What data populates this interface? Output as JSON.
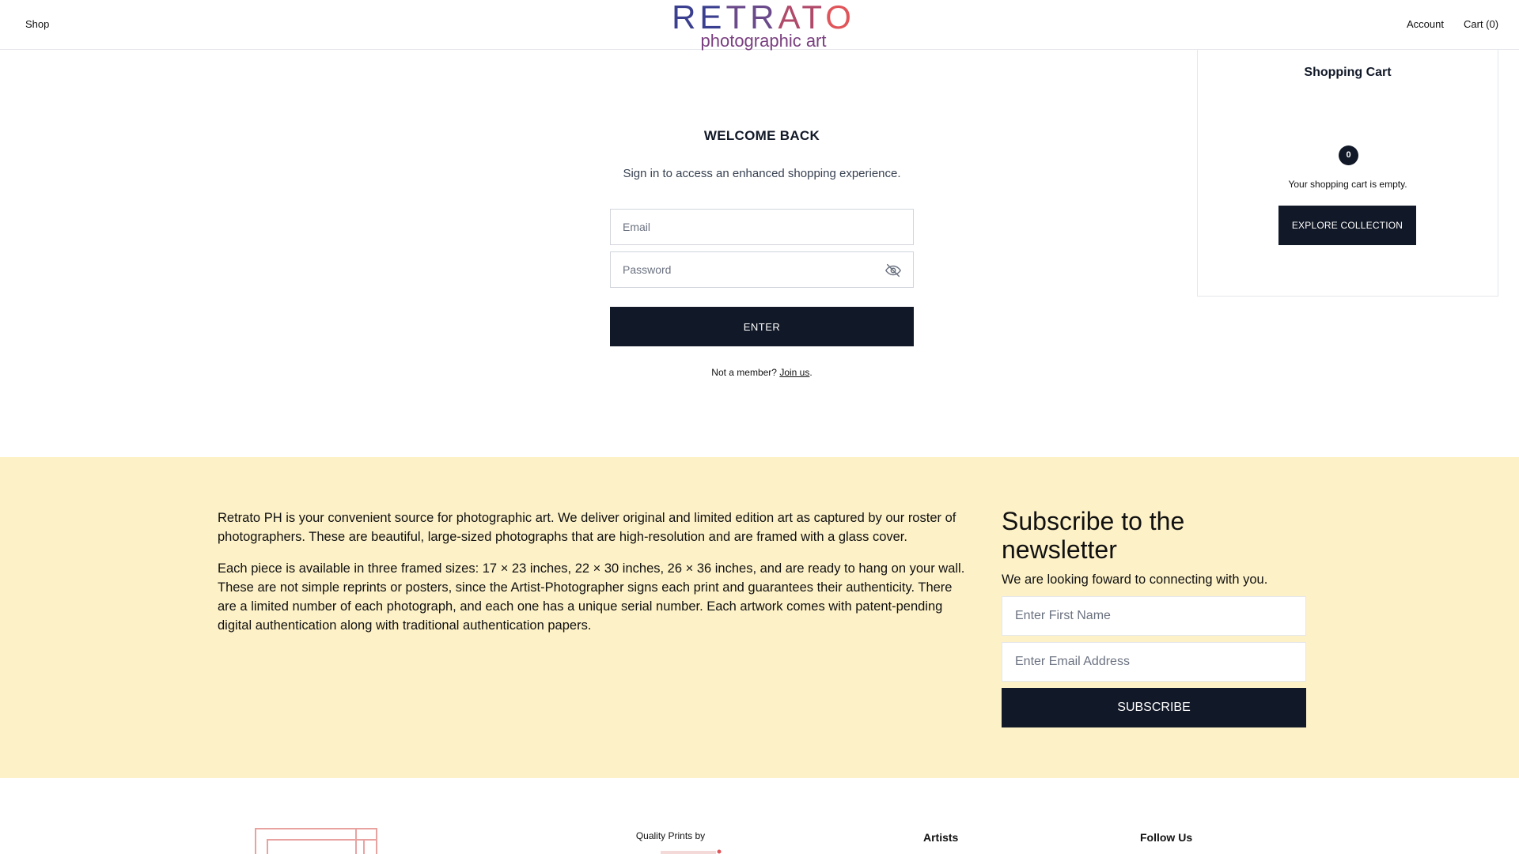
{
  "header": {
    "shop_label": "Shop",
    "account_label": "Account",
    "cart_label": "Cart (0)",
    "logo_main": "RETRATO",
    "logo_sub": "photographic art"
  },
  "login": {
    "title": "WELCOME BACK",
    "subtitle": "Sign in to access an enhanced shopping experience.",
    "email_placeholder": "Email",
    "password_placeholder": "Password",
    "enter_label": "ENTER",
    "member_prefix": "Not a member? ",
    "join_label": "Join us",
    "member_suffix": "."
  },
  "cart": {
    "title": "Shopping Cart",
    "count": "0",
    "empty_text": "Your shopping cart is empty.",
    "explore_label": "EXPLORE COLLECTION"
  },
  "about": {
    "p1": "Retrato PH is your convenient source for photographic art. We deliver original and limited edition art as captured by our roster of photographers. These are beautiful, large-sized photographs that are high-resolution and are framed with a glass cover.",
    "p2": "Each piece is available in three framed sizes: 17 × 23 inches, 22 × 30 inches, 26 × 36 inches, and are ready to hang on your wall. These are not simple reprints or posters, since the Artist-Photographer signs each print and guarantees their authenticity. There are a limited number of each photograph, and each one has a unique serial number. Each artwork comes with patent-pending digital authentication along with traditional authentication papers."
  },
  "newsletter": {
    "title": "Subscribe to the newsletter",
    "subtitle": "We are looking foward to connecting with you.",
    "first_name_placeholder": "Enter First Name",
    "email_placeholder": "Enter Email Address",
    "subscribe_label": "SUBSCRIBE"
  },
  "footer": {
    "quality_label": "Quality Prints by",
    "artists_heading": "Artists",
    "follow_heading": "Follow Us"
  },
  "colors": {
    "accent_dark": "#111827",
    "band_bg": "#fdf1c7",
    "logo_blue": "#3b3f8f",
    "logo_purple": "#7a3f80",
    "logo_red": "#e0555a"
  },
  "icons": [
    "eye-off-icon"
  ]
}
